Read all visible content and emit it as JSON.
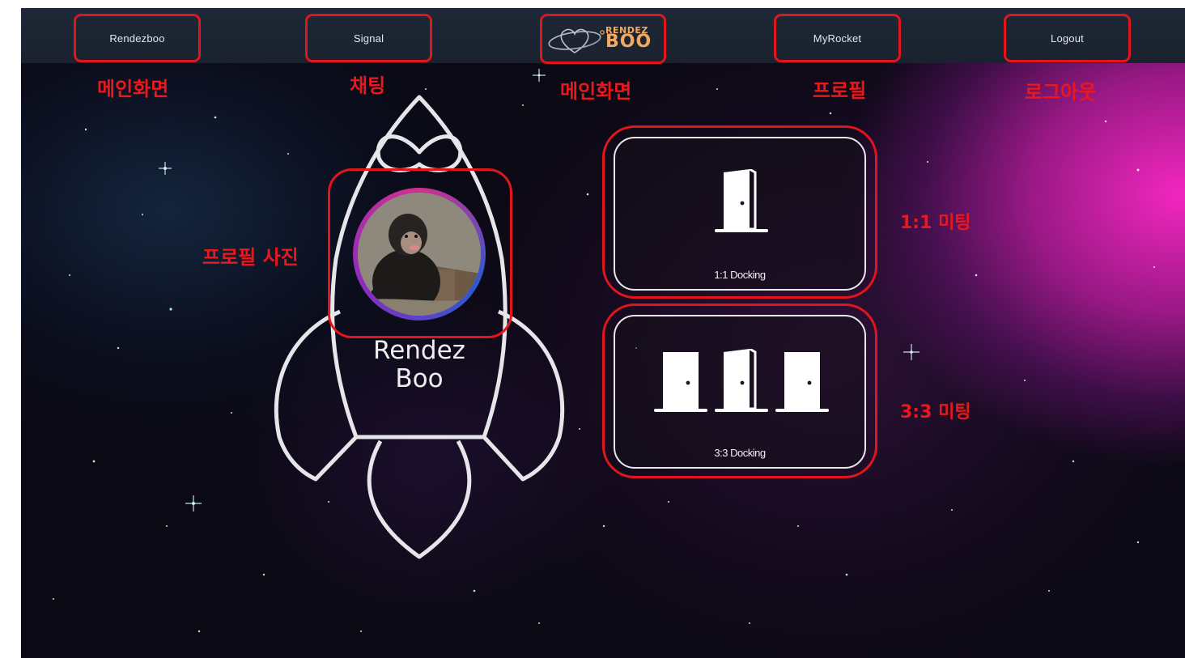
{
  "nav": {
    "home_label": "Rendezboo",
    "signal_label": "Signal",
    "myrocket_label": "MyRocket",
    "logout_label": "Logout"
  },
  "logo": {
    "line1": "RENDEZ",
    "line2": "BOO"
  },
  "annotations": {
    "home": "메인화면",
    "signal": "채팅",
    "logo": "메인화면",
    "myrocket": "프로필",
    "logout": "로그아웃",
    "profile_photo": "프로필 사진",
    "one_on_one": "1:1 미팅",
    "three_on_three": "3:3 미팅"
  },
  "rocket": {
    "title_line1": "Rendez",
    "title_line2": "Boo"
  },
  "docking": {
    "one_label": "1:1 Docking",
    "three_label": "3:3 Docking"
  },
  "icons": {
    "door": "door-icon",
    "rocket": "rocket-outline-icon",
    "logo": "planet-heart-icon"
  },
  "colors": {
    "annotation": "#e0161c",
    "nav_bg": "#1e2836",
    "logo": "#f3a860",
    "accent_pink": "#ff28c8"
  }
}
